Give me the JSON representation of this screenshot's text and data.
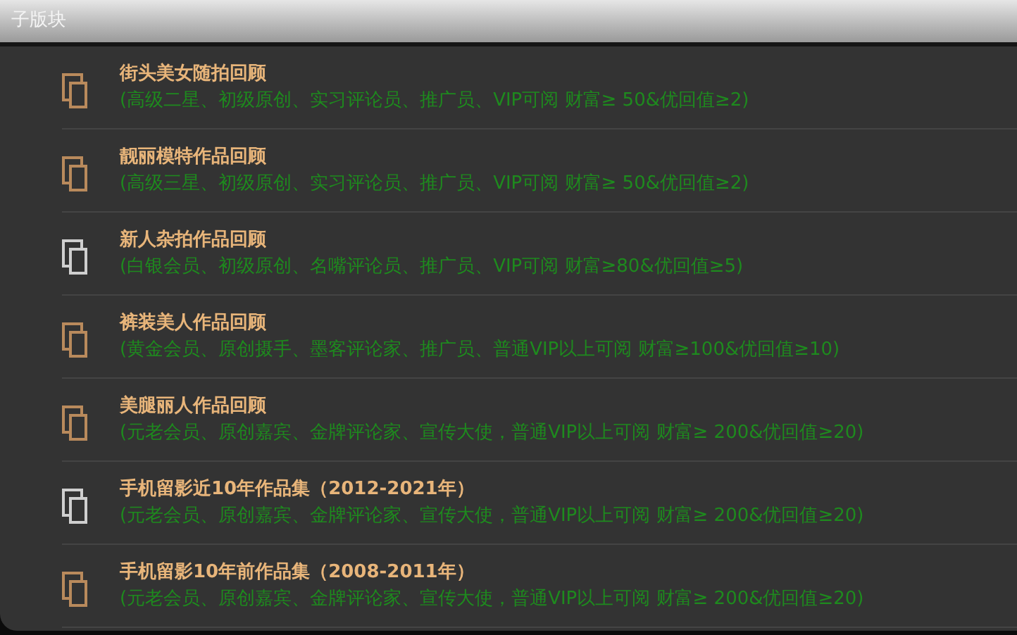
{
  "panel": {
    "title": "子版块"
  },
  "forums": [
    {
      "name": "街头美女随拍回顾",
      "note": "(高级二星、初级原创、实习评论员、推广员、VIP可阅  财富≥ 50&优回值≥2)",
      "color": "#b98a5c"
    },
    {
      "name": "靓丽模特作品回顾",
      "note": "(高级三星、初级原创、实习评论员、推广员、VIP可阅  财富≥ 50&优回值≥2)",
      "color": "#b98a5c"
    },
    {
      "name": "新人杂拍作品回顾",
      "note": "(白银会员、初级原创、名嘴评论员、推广员、VIP可阅 财富≥80&优回值≥5)",
      "color": "#cfcfcf"
    },
    {
      "name": "裤装美人作品回顾",
      "note": "(黄金会员、原创摄手、墨客评论家、推广员、普通VIP以上可阅 财富≥100&优回值≥10)",
      "color": "#b98a5c"
    },
    {
      "name": "美腿丽人作品回顾",
      "note": "(元老会员、原创嘉宾、金牌评论家、宣传大使，普通VIP以上可阅  财富≥ 200&优回值≥20)",
      "color": "#b98a5c"
    },
    {
      "name": "手机留影近10年作品集（2012-2021年）",
      "note": "(元老会员、原创嘉宾、金牌评论家、宣传大使，普通VIP以上可阅  财富≥ 200&优回值≥20)",
      "color": "#cfcfcf"
    },
    {
      "name": "手机留影10年前作品集（2008-2011年）",
      "note": "(元老会员、原创嘉宾、金牌评论家、宣传大使，普通VIP以上可阅  财富≥ 200&优回值≥20)",
      "color": "#b98a5c"
    }
  ]
}
